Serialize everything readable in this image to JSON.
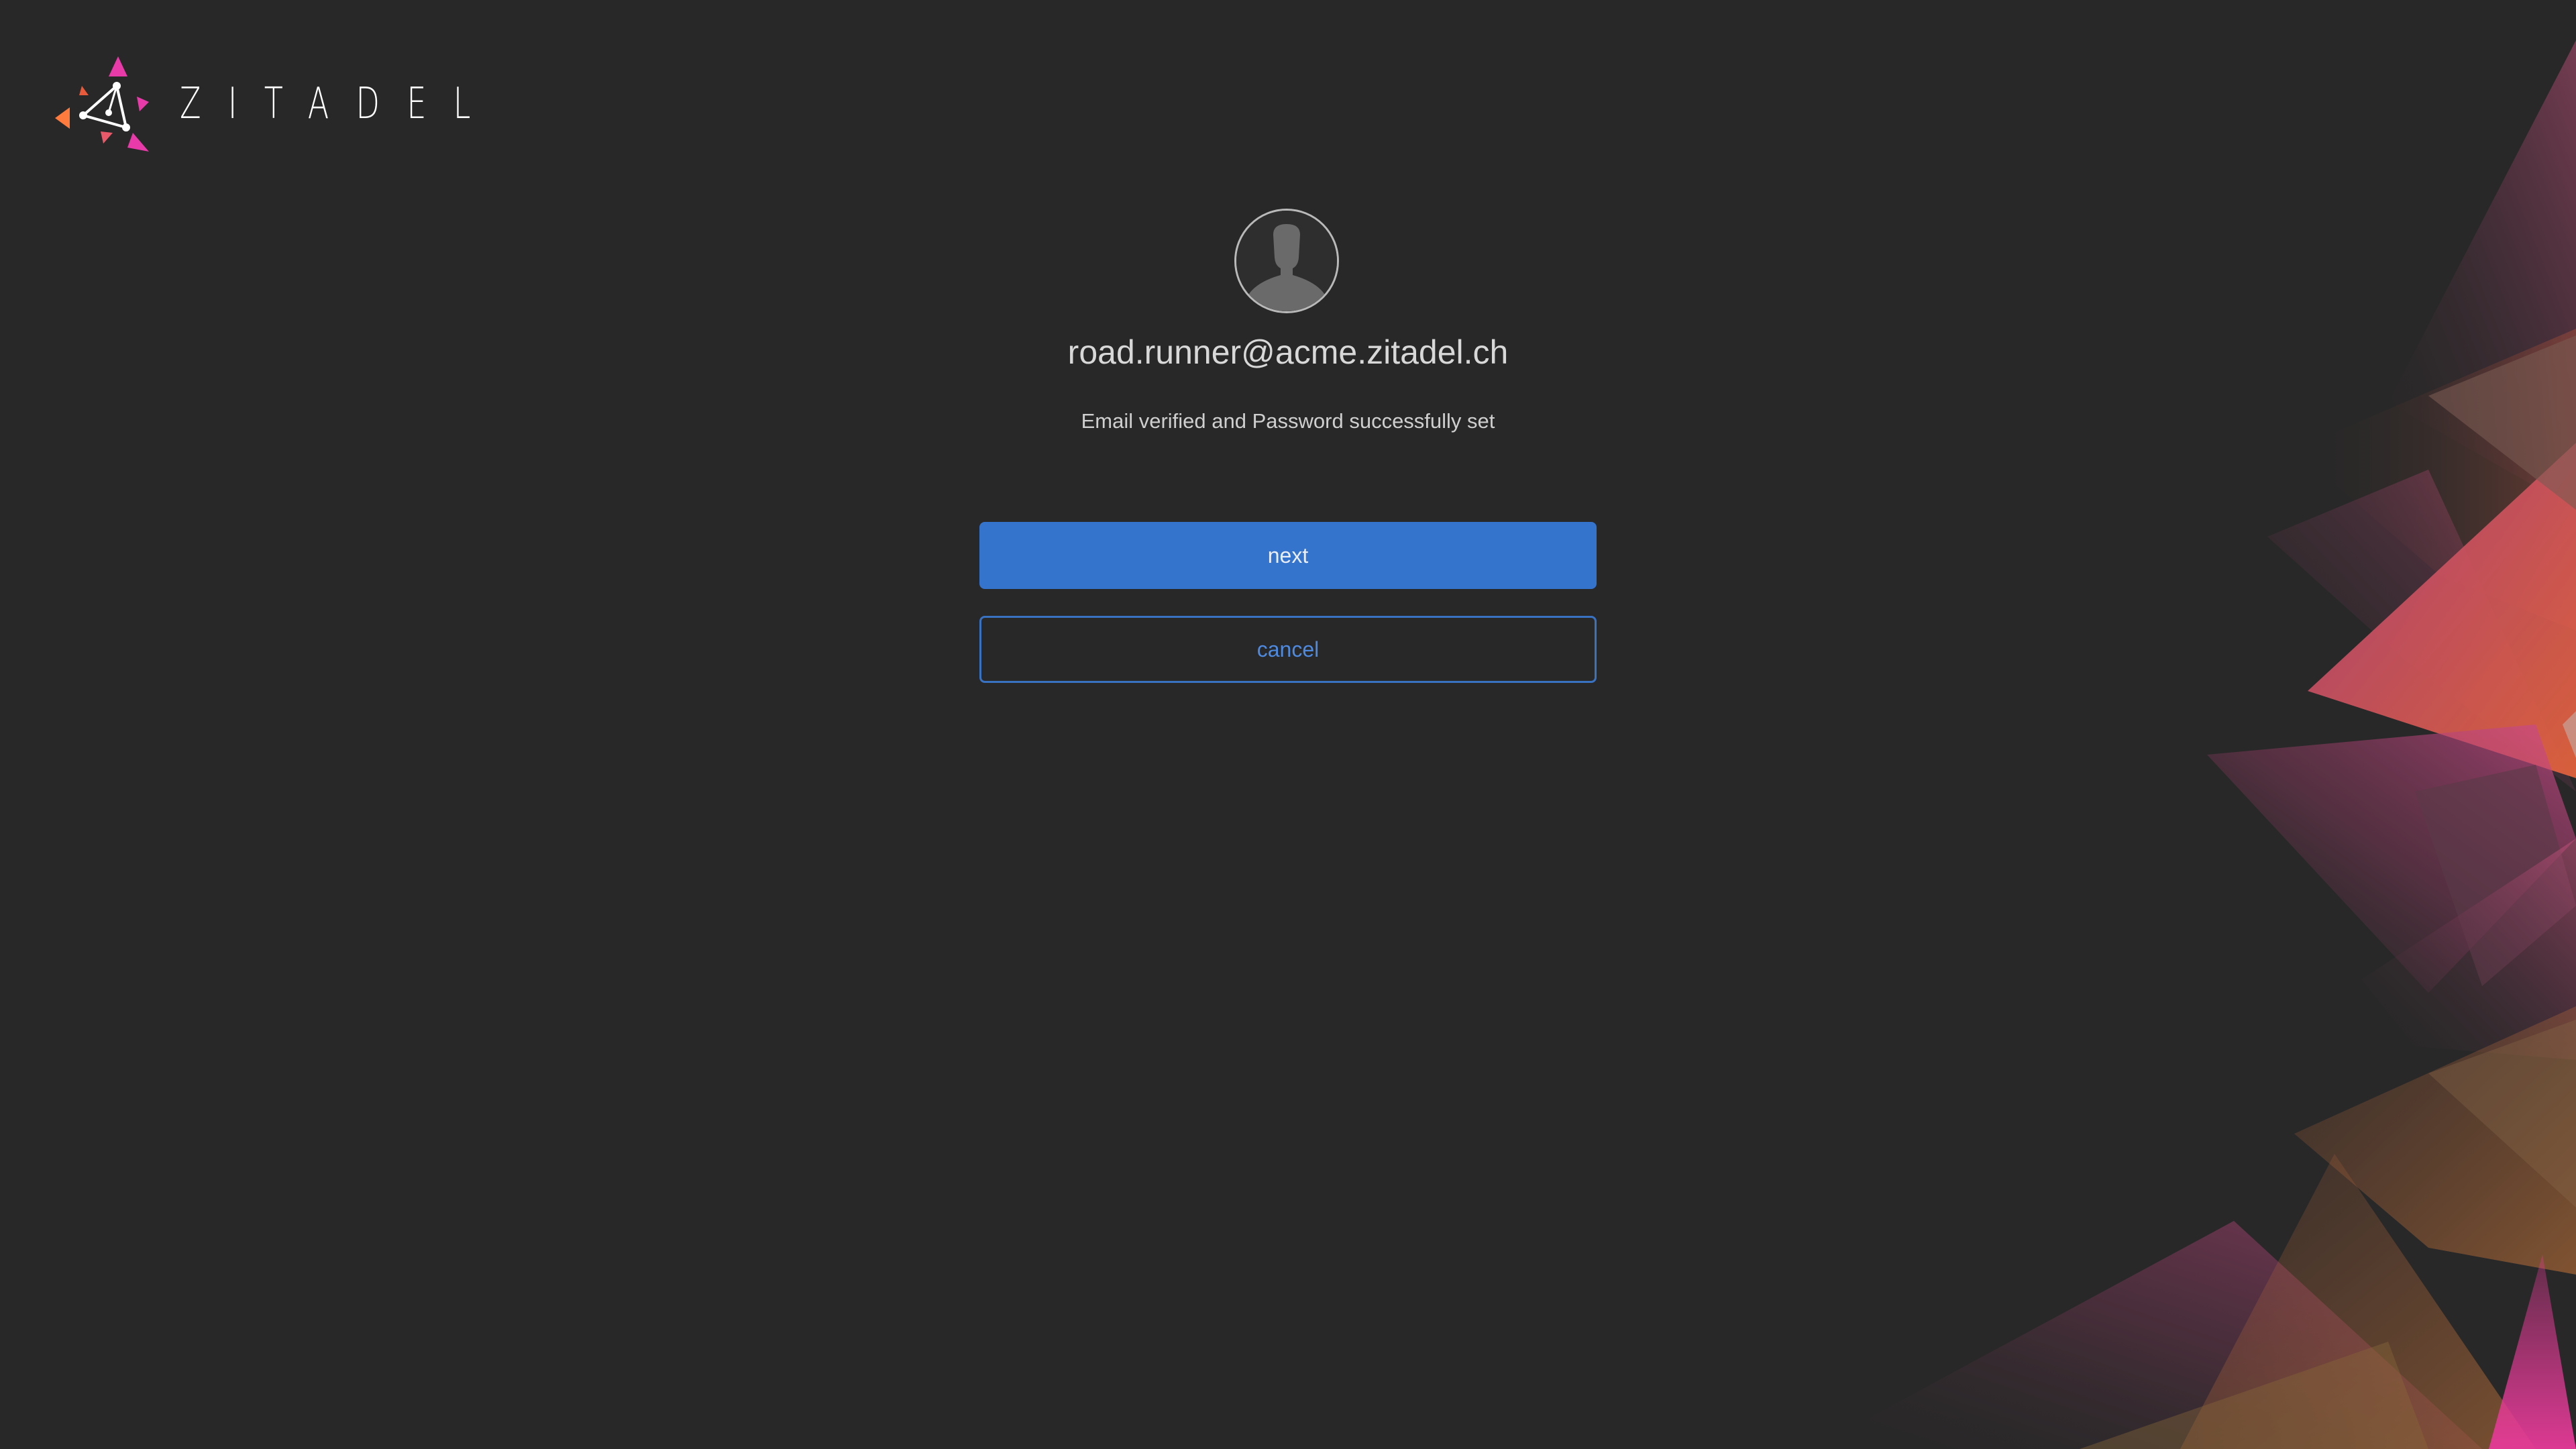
{
  "brand": {
    "name": "ZITADEL"
  },
  "user": {
    "login_name": "road.runner@acme.zitadel.ch"
  },
  "message": "Email verified and Password successfully set",
  "buttons": {
    "next_label": "next",
    "cancel_label": "cancel"
  },
  "colors": {
    "background": "#282828",
    "primary": "#3574cc",
    "brand_pink": "#e83aa8",
    "brand_orange": "#ff7a3d"
  },
  "icons": {
    "logo": "zitadel-logo-icon",
    "avatar": "user-silhouette-icon"
  }
}
